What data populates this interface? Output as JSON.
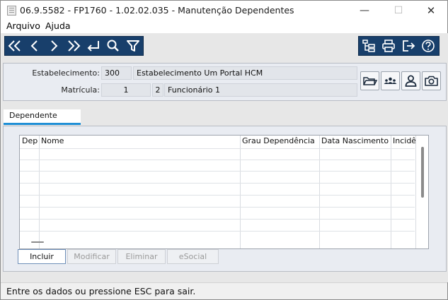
{
  "window": {
    "title": "06.9.5582 - FP1760 - 1.02.02.035 - Manutenção Dependentes",
    "minimize": "—",
    "maximize": "☐",
    "close": "✕"
  },
  "menu": [
    "Arquivo",
    "Ajuda"
  ],
  "toolbar": {
    "left_icons": [
      "first-record-icon",
      "previous-record-icon",
      "next-record-icon",
      "last-record-icon",
      "enter-icon",
      "search-icon",
      "filter-icon"
    ],
    "right_icons": [
      "hierarchy-icon",
      "print-icon",
      "exit-icon",
      "help-icon"
    ],
    "colors": {
      "background": "#183f6b",
      "icon": "#ffffff"
    }
  },
  "header": {
    "estabelecimento": {
      "label": "Estabelecimento:",
      "code": "300",
      "name": "Estabelecimento Um Portal HCM"
    },
    "matricula": {
      "label": "Matrícula:",
      "number": "1",
      "digit": "2",
      "name": "Funcionário 1"
    },
    "side_icons": [
      "folder-open-icon",
      "group-icon",
      "person-icon",
      "camera-icon"
    ]
  },
  "tabs": [
    {
      "label": "Dependente",
      "active": true
    }
  ],
  "tab_accent": "#1f8fd6",
  "grid": {
    "columns": [
      "Dep",
      "Nome",
      "Grau Dependência",
      "Data Nascimento",
      "Incidên"
    ],
    "rows": []
  },
  "buttons": {
    "incluir": "Incluir",
    "modificar": "Modificar",
    "eliminar": "Eliminar",
    "esocial": "eSocial"
  },
  "status": "Entre os dados ou pressione ESC para sair."
}
